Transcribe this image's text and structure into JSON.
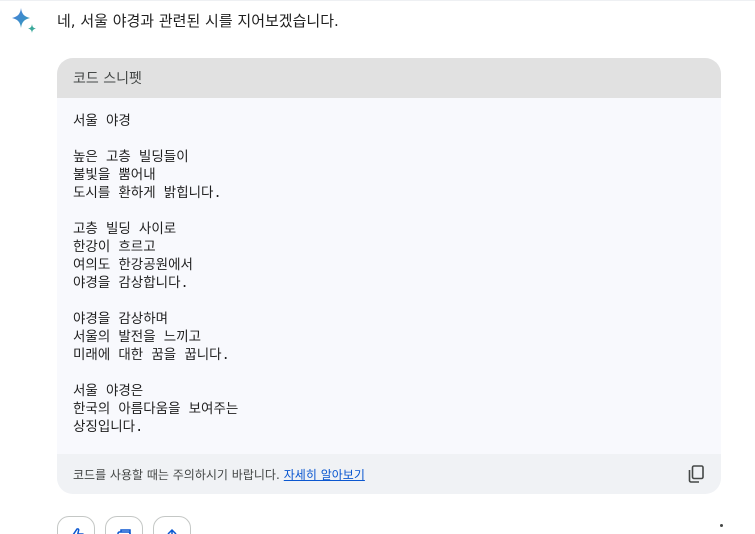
{
  "response": {
    "intro_text": "네, 서울 야경과 관련된 시를 지어보겠습니다."
  },
  "code_snippet": {
    "header_label": "코드 스니펫",
    "lines": [
      "서울 야경",
      "",
      "높은 고층 빌딩들이",
      "불빛을 뿜어내",
      "도시를 환하게 밝힙니다.",
      "",
      "고층 빌딩 사이로",
      "한강이 흐르고",
      "여의도 한강공원에서",
      "야경을 감상합니다.",
      "",
      "야경을 감상하며",
      "서울의 발전을 느끼고",
      "미래에 대한 꿈을 꿉니다.",
      "",
      "서울 야경은",
      "한국의 아름다움을 보여주는",
      "상징입니다."
    ],
    "footer_notice": "코드를 사용할 때는 주의하시기 바랍니다.",
    "footer_link": "자세히 알아보기",
    "copy_icon": "copy-icon"
  },
  "actions": {
    "icons": [
      "thumbs-up-icon",
      "share-icon",
      "export-icon",
      "more-vert-icon"
    ]
  },
  "colors": {
    "header_bg": "#e1e1e1",
    "body_bg": "#f8f9fd",
    "footer_bg": "#f0f2f5",
    "link": "#0b57d0",
    "spark_blue": "#4285f4",
    "spark_teal": "#34a853"
  }
}
